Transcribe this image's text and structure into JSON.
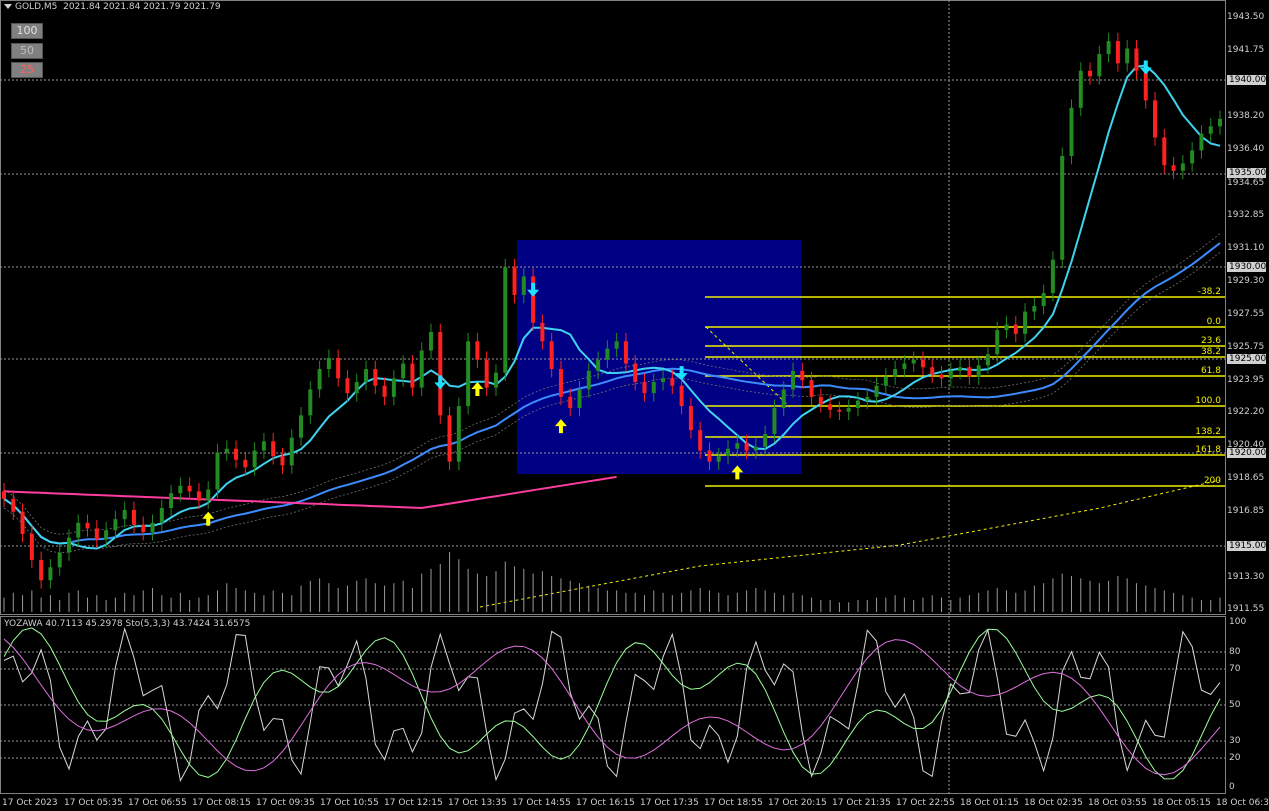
{
  "header": {
    "symbol": "GOLD,M5",
    "ohlc": "2021.84 2021.84 2021.79 2021.79"
  },
  "depth_buttons": [
    "100",
    "50",
    "25"
  ],
  "indicator_label": "YOZAWA 40.7113 45.2978  Sto(5,3,3) 43.7424 31.6575",
  "price_axis": {
    "labels": [
      "1943.50",
      "1941.75",
      "1940.00",
      "1938.20",
      "1936.40",
      "1935.00",
      "1934.65",
      "1932.85",
      "1931.10",
      "1930.00",
      "1929.30",
      "1927.55",
      "1925.75",
      "1925.00",
      "1923.95",
      "1922.20",
      "1920.40",
      "1920.00",
      "1918.65",
      "1916.85",
      "1915.00",
      "1913.30",
      "1911.55"
    ],
    "boxed": [
      "1940.00",
      "1935.00",
      "1930.00",
      "1925.00",
      "1920.00",
      "1915.00"
    ]
  },
  "indicator_axis": {
    "labels": [
      "100",
      "80",
      "70",
      "50",
      "30",
      "20",
      "0"
    ]
  },
  "time_axis": [
    "17 Oct 2023",
    "17 Oct 05:35",
    "17 Oct 06:55",
    "17 Oct 08:15",
    "17 Oct 09:35",
    "17 Oct 10:55",
    "17 Oct 12:15",
    "17 Oct 13:35",
    "17 Oct 14:55",
    "17 Oct 16:15",
    "17 Oct 17:35",
    "17 Oct 18:55",
    "17 Oct 20:15",
    "17 Oct 21:35",
    "17 Oct 22:55",
    "18 Oct 01:15",
    "18 Oct 02:35",
    "18 Oct 03:55",
    "18 Oct 05:15",
    "18 Oct 06:35"
  ],
  "fibonacci_levels": [
    "-38.2",
    "0.0",
    "23.6",
    "38.2",
    "61.8",
    "100.0",
    "138.2",
    "161.8",
    "200"
  ],
  "colors": {
    "background": "#000000",
    "bull_candle": "#228b22",
    "bear_candle": "#ff2020",
    "fast_ma": "#3fd3f0",
    "slow_ma": "#3c8cff",
    "pink_ma": "#ff3ca0",
    "fib_line": "#f0f000",
    "highlight_box": "#00008b",
    "up_arrow": "#ffff00",
    "down_arrow": "#20e0ff"
  },
  "chart_data": {
    "type": "line",
    "title": "GOLD,M5",
    "price_range": [
      1911.55,
      1943.5
    ],
    "close_series": [
      1917.5,
      1916.8,
      1915.6,
      1914.2,
      1913.1,
      1913.8,
      1914.6,
      1915.4,
      1916.2,
      1915.9,
      1915.3,
      1915.8,
      1916.4,
      1916.9,
      1916.1,
      1915.7,
      1916.2,
      1917.0,
      1917.8,
      1918.2,
      1917.9,
      1917.4,
      1918.0,
      1920.0,
      1920.2,
      1919.6,
      1919.2,
      1920.1,
      1920.6,
      1919.8,
      1919.3,
      1920.8,
      1922.0,
      1923.4,
      1924.5,
      1925.1,
      1924.0,
      1923.2,
      1923.8,
      1924.5,
      1923.6,
      1923.0,
      1924.0,
      1924.8,
      1923.5,
      1925.5,
      1926.5,
      1922.0,
      1919.5,
      1922.5,
      1926.0,
      1925.0,
      1923.5,
      1924.3,
      1930.0,
      1928.5,
      1929.5,
      1927.0,
      1926.0,
      1924.5,
      1923.0,
      1922.4,
      1923.4,
      1924.4,
      1925.0,
      1925.6,
      1926.0,
      1924.8,
      1923.8,
      1923.2,
      1923.8,
      1924.0,
      1923.6,
      1922.5,
      1921.2,
      1920.1,
      1919.5,
      1919.8,
      1920.2,
      1920.5,
      1920.1,
      1920.3,
      1921.0,
      1922.4,
      1923.4,
      1924.4,
      1923.9,
      1923.0,
      1922.6,
      1922.3,
      1922.2,
      1922.4,
      1922.8,
      1923.0,
      1923.6,
      1924.1,
      1924.5,
      1924.8,
      1925.0,
      1924.6,
      1924.2,
      1924.0,
      1924.4,
      1924.6,
      1924.1,
      1924.7,
      1925.3,
      1926.6,
      1926.9,
      1926.4,
      1927.6,
      1927.9,
      1928.6,
      1930.4,
      1936.0,
      1938.6,
      1940.6,
      1940.3,
      1941.5,
      1942.2,
      1941.0,
      1941.8,
      1940.6,
      1939.0,
      1937.0,
      1935.5,
      1935.2,
      1935.6,
      1936.3,
      1937.2,
      1937.6,
      1938.0
    ],
    "volume": [
      6,
      8,
      7,
      9,
      6,
      7,
      5,
      8,
      9,
      6,
      7,
      5,
      6,
      8,
      7,
      9,
      10,
      7,
      6,
      8,
      5,
      6,
      7,
      9,
      12,
      10,
      9,
      8,
      7,
      9,
      8,
      7,
      11,
      13,
      14,
      12,
      10,
      11,
      13,
      14,
      12,
      11,
      12,
      13,
      10,
      16,
      18,
      20,
      25,
      22,
      18,
      16,
      15,
      17,
      21,
      19,
      18,
      16,
      17,
      15,
      14,
      13,
      12,
      11,
      10,
      9,
      9,
      8,
      8,
      7,
      9,
      8,
      7,
      8,
      9,
      10,
      9,
      8,
      7,
      8,
      9,
      10,
      9,
      8,
      7,
      8,
      7,
      6,
      5,
      5,
      4,
      4,
      5,
      5,
      6,
      6,
      7,
      6,
      5,
      6,
      7,
      6,
      5,
      6,
      7,
      8,
      9,
      10,
      9,
      8,
      9,
      11,
      12,
      14,
      16,
      15,
      14,
      13,
      12,
      13,
      15,
      14,
      12,
      11,
      10,
      9,
      8,
      7,
      6,
      5,
      5,
      6
    ]
  }
}
